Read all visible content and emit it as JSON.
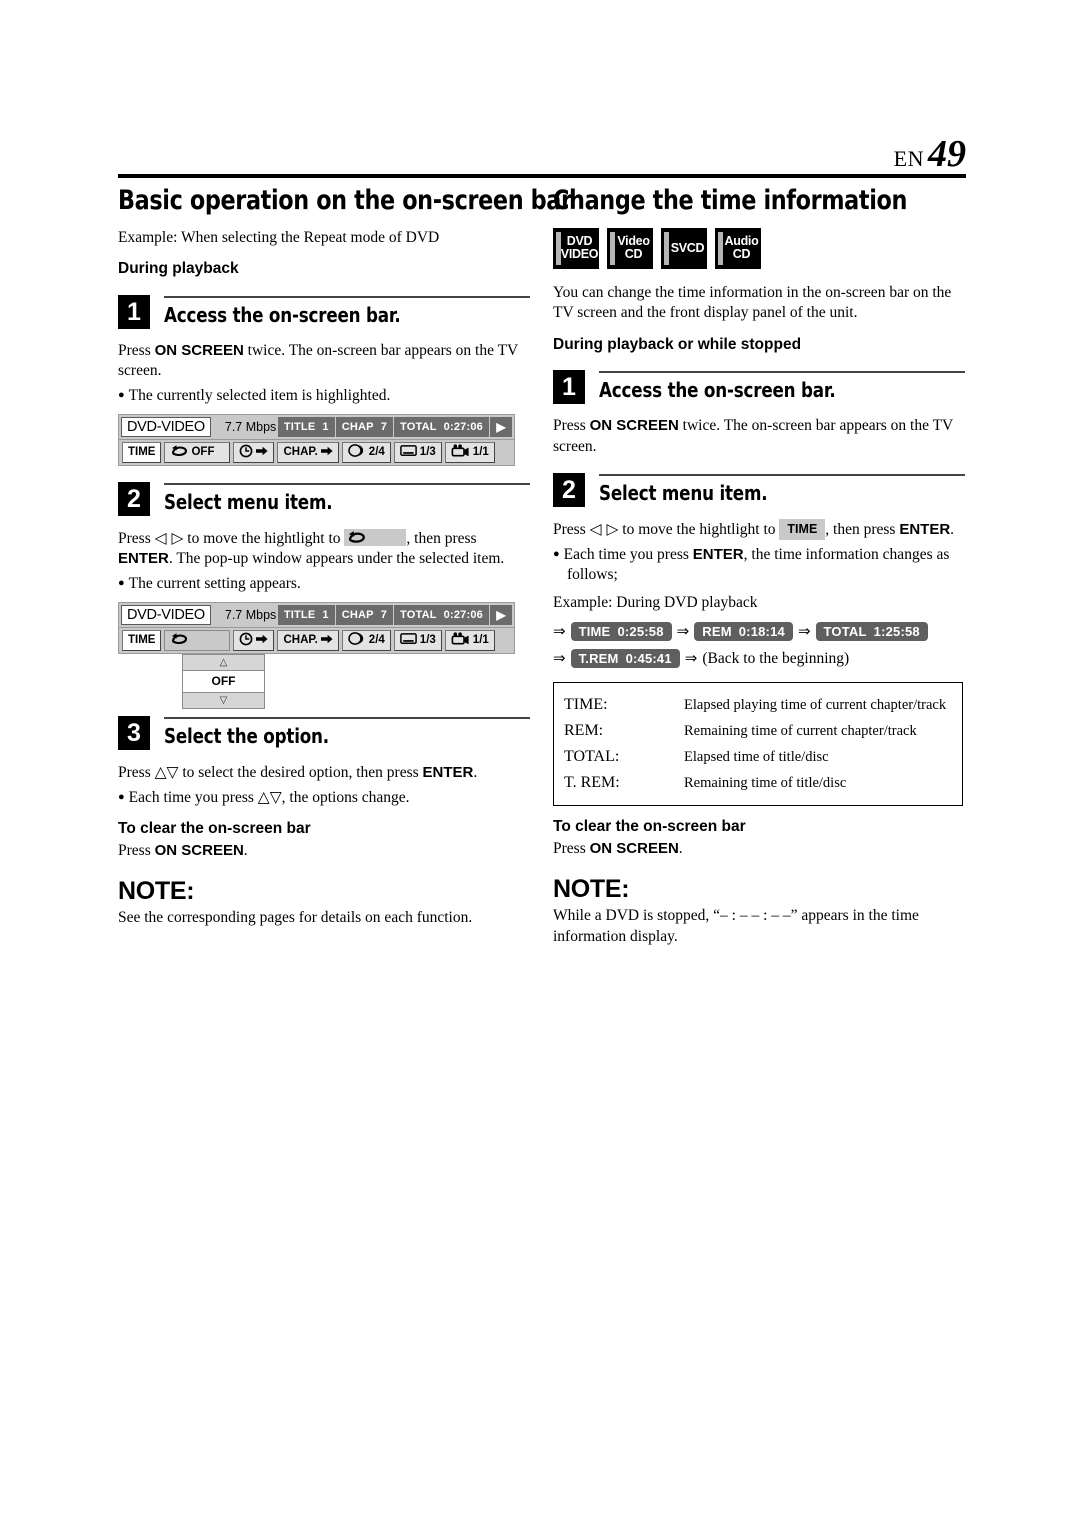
{
  "header": {
    "lang": "EN",
    "page_number": "49"
  },
  "left": {
    "section_title": "Basic operation on the on-screen bar",
    "example_line": "Example: When selecting the Repeat mode of DVD",
    "subhead": "During playback",
    "step1": {
      "number": "1",
      "title": "Access the on-screen bar.",
      "body_pre": "Press ",
      "body_bold": "ON SCREEN",
      "body_post": " twice. The on-screen bar appears on the TV screen.",
      "bullet": "The currently selected item is highlighted."
    },
    "osd1": {
      "disc_type": "DVD-VIDEO",
      "bitrate": "7.7 Mbps",
      "title_label": "TITLE",
      "title_value": "1",
      "chap_label": "CHAP",
      "chap_value": "7",
      "total_label": "TOTAL",
      "total_value": "0:27:06",
      "btn_time": "TIME",
      "btn_repeat": "OFF",
      "btn_chap": "CHAP.",
      "audio_value": "2/4",
      "subtitle_value": "1/3",
      "angle_value": "1/1"
    },
    "step2": {
      "number": "2",
      "title": "Select menu item.",
      "body_pre": "Press ",
      "body_keys": "◁ ▷",
      "body_mid": " to move the hightlight to ",
      "body_after_tag": ", then press ",
      "body_bold": "ENTER",
      "body_post": ". The pop-up window appears under the selected item.",
      "bullet": "The current setting appears."
    },
    "osd2": {
      "disc_type": "DVD-VIDEO",
      "bitrate": "7.7 Mbps",
      "title_label": "TITLE",
      "title_value": "1",
      "chap_label": "CHAP",
      "chap_value": "7",
      "total_label": "TOTAL",
      "total_value": "0:27:06",
      "btn_time": "TIME",
      "btn_chap": "CHAP.",
      "audio_value": "2/4",
      "subtitle_value": "1/3",
      "angle_value": "1/1",
      "popup_value": "OFF",
      "popup_up": "△",
      "popup_down": "▽"
    },
    "step3": {
      "number": "3",
      "title": "Select the option.",
      "body_pre": "Press ",
      "body_keys": "△▽",
      "body_mid": " to select the desired option, then press ",
      "body_bold": "ENTER",
      "body_post": ".",
      "bullet_pre": "Each time you press ",
      "bullet_keys": "△▽",
      "bullet_post": ", the options change."
    },
    "clear_heading": "To clear the on-screen bar",
    "clear_pre": "Press ",
    "clear_bold": "ON SCREEN",
    "clear_post": ".",
    "note_heading": "NOTE:",
    "note_body": "See the corresponding pages for details on each function."
  },
  "right": {
    "section_title": "Change the time information",
    "badges": [
      {
        "line1": "DVD",
        "line2": "VIDEO"
      },
      {
        "line1": "Video",
        "line2": "CD"
      },
      {
        "line1": "SVCD",
        "line2": ""
      },
      {
        "line1": "Audio",
        "line2": "CD"
      }
    ],
    "intro": "You can change the time information in the on-screen bar on the TV screen and the front display panel of the unit.",
    "subhead": "During playback or while stopped",
    "step1": {
      "number": "1",
      "title": "Access the on-screen bar.",
      "body_pre": "Press ",
      "body_bold": "ON SCREEN",
      "body_post": " twice. The on-screen bar appears on the TV screen."
    },
    "step2": {
      "number": "2",
      "title": "Select menu item.",
      "body_pre": "Press ",
      "body_keys": "◁ ▷",
      "body_mid": " to move the hightlight to ",
      "tag": "TIME",
      "body_after_tag": ", then press ",
      "body_bold": "ENTER",
      "body_post": ".",
      "bullet_pre": "Each time you press ",
      "bullet_bold": "ENTER",
      "bullet_post": ", the time information changes as follows;",
      "example_line": "Example: During DVD playback"
    },
    "flow_row1": [
      {
        "label": "TIME",
        "value": "0:25:58"
      },
      {
        "label": "REM",
        "value": "0:18:14"
      },
      {
        "label": "TOTAL",
        "value": "1:25:58"
      }
    ],
    "flow_row2": {
      "label": "T.REM",
      "value": "0:45:41",
      "tail": "(Back to the beginning)"
    },
    "table": [
      {
        "key": "TIME:",
        "desc": "Elapsed playing time of current chapter/track"
      },
      {
        "key": "REM:",
        "desc": "Remaining time of current chapter/track"
      },
      {
        "key": "TOTAL:",
        "desc": "Elapsed time of title/disc"
      },
      {
        "key": "T. REM:",
        "desc": "Remaining time of title/disc"
      }
    ],
    "clear_heading": "To clear the on-screen bar",
    "clear_pre": "Press ",
    "clear_bold": "ON SCREEN",
    "clear_post": ".",
    "note_heading": "NOTE:",
    "note_body": "While a DVD is stopped, “– : – – : – –” appears in the time information display."
  },
  "icons": {
    "repeat": "repeat-icon",
    "time_arrow": "clock-arrow-icon",
    "chapter_arrow": "chapter-arrow-icon",
    "audio": "audio-track-icon",
    "subtitle": "subtitle-icon",
    "angle": "camera-angle-icon",
    "play": "play-triangle-icon"
  },
  "colors": {
    "osd_bg": "#c9c9c9",
    "osd_tag": "#6b6b6b",
    "badge_bg": "#000000",
    "time_badge": "#5f5f5f"
  }
}
